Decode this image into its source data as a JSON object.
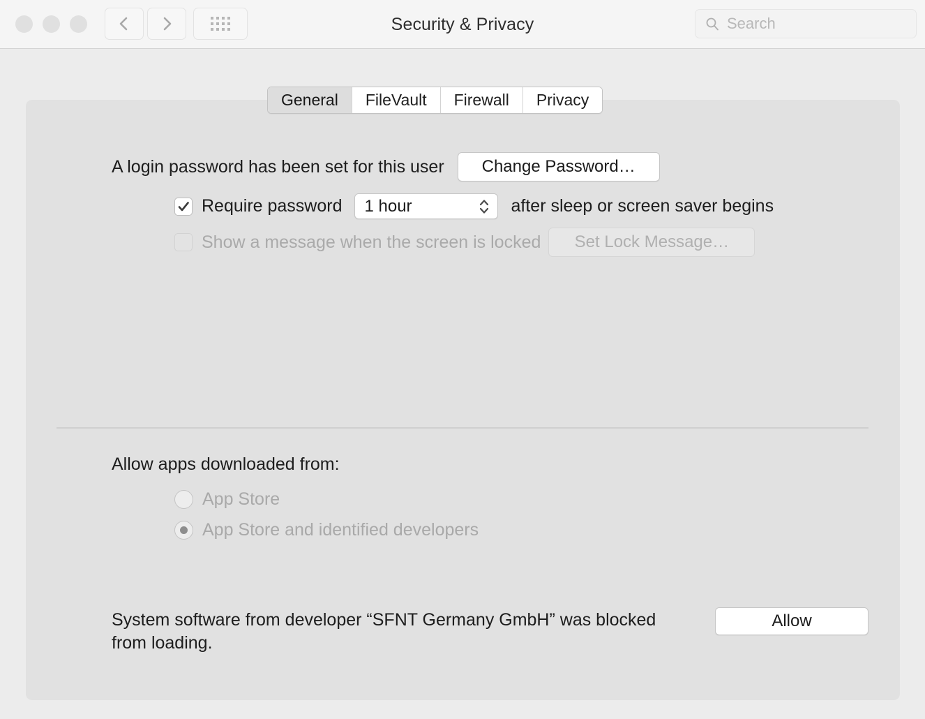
{
  "window": {
    "title": "Security & Privacy",
    "traffic_lights": [
      "close",
      "minimize",
      "zoom"
    ],
    "nav": {
      "back_icon": "chevron-left-icon",
      "forward_icon": "chevron-right-icon",
      "grid_icon": "grid-view-icon"
    },
    "search": {
      "icon": "search-icon",
      "placeholder": "Search",
      "value": ""
    }
  },
  "tabs": [
    {
      "label": "General",
      "selected": true
    },
    {
      "label": "FileVault",
      "selected": false
    },
    {
      "label": "Firewall",
      "selected": false
    },
    {
      "label": "Privacy",
      "selected": false
    }
  ],
  "general": {
    "password_status": "A login password has been set for this user",
    "change_password_label": "Change Password…",
    "require_password": {
      "checked": true,
      "label": "Require password",
      "delay_value": "1 hour",
      "stepper_icon": "stepper-updown-icon",
      "trailing": "after sleep or screen saver begins"
    },
    "lock_message": {
      "checked": false,
      "enabled": false,
      "label": "Show a message when the screen is locked",
      "button_label": "Set Lock Message…"
    },
    "allow_apps": {
      "heading": "Allow apps downloaded from:",
      "options": [
        {
          "label": "App Store",
          "selected": false
        },
        {
          "label": "App Store and identified developers",
          "selected": true
        }
      ],
      "enabled": false
    },
    "blocked_notice": {
      "text": "System software from developer “SFNT Germany GmbH” was blocked from loading.",
      "action_label": "Allow"
    }
  },
  "colors": {
    "window_bg": "#ececec",
    "toolbar_bg": "#f5f5f5",
    "panel_bg": "#e1e1e1",
    "text": "#1d1d1d",
    "text_disabled": "#a9a9a9",
    "selected_tab_bg": "#dddddd"
  }
}
